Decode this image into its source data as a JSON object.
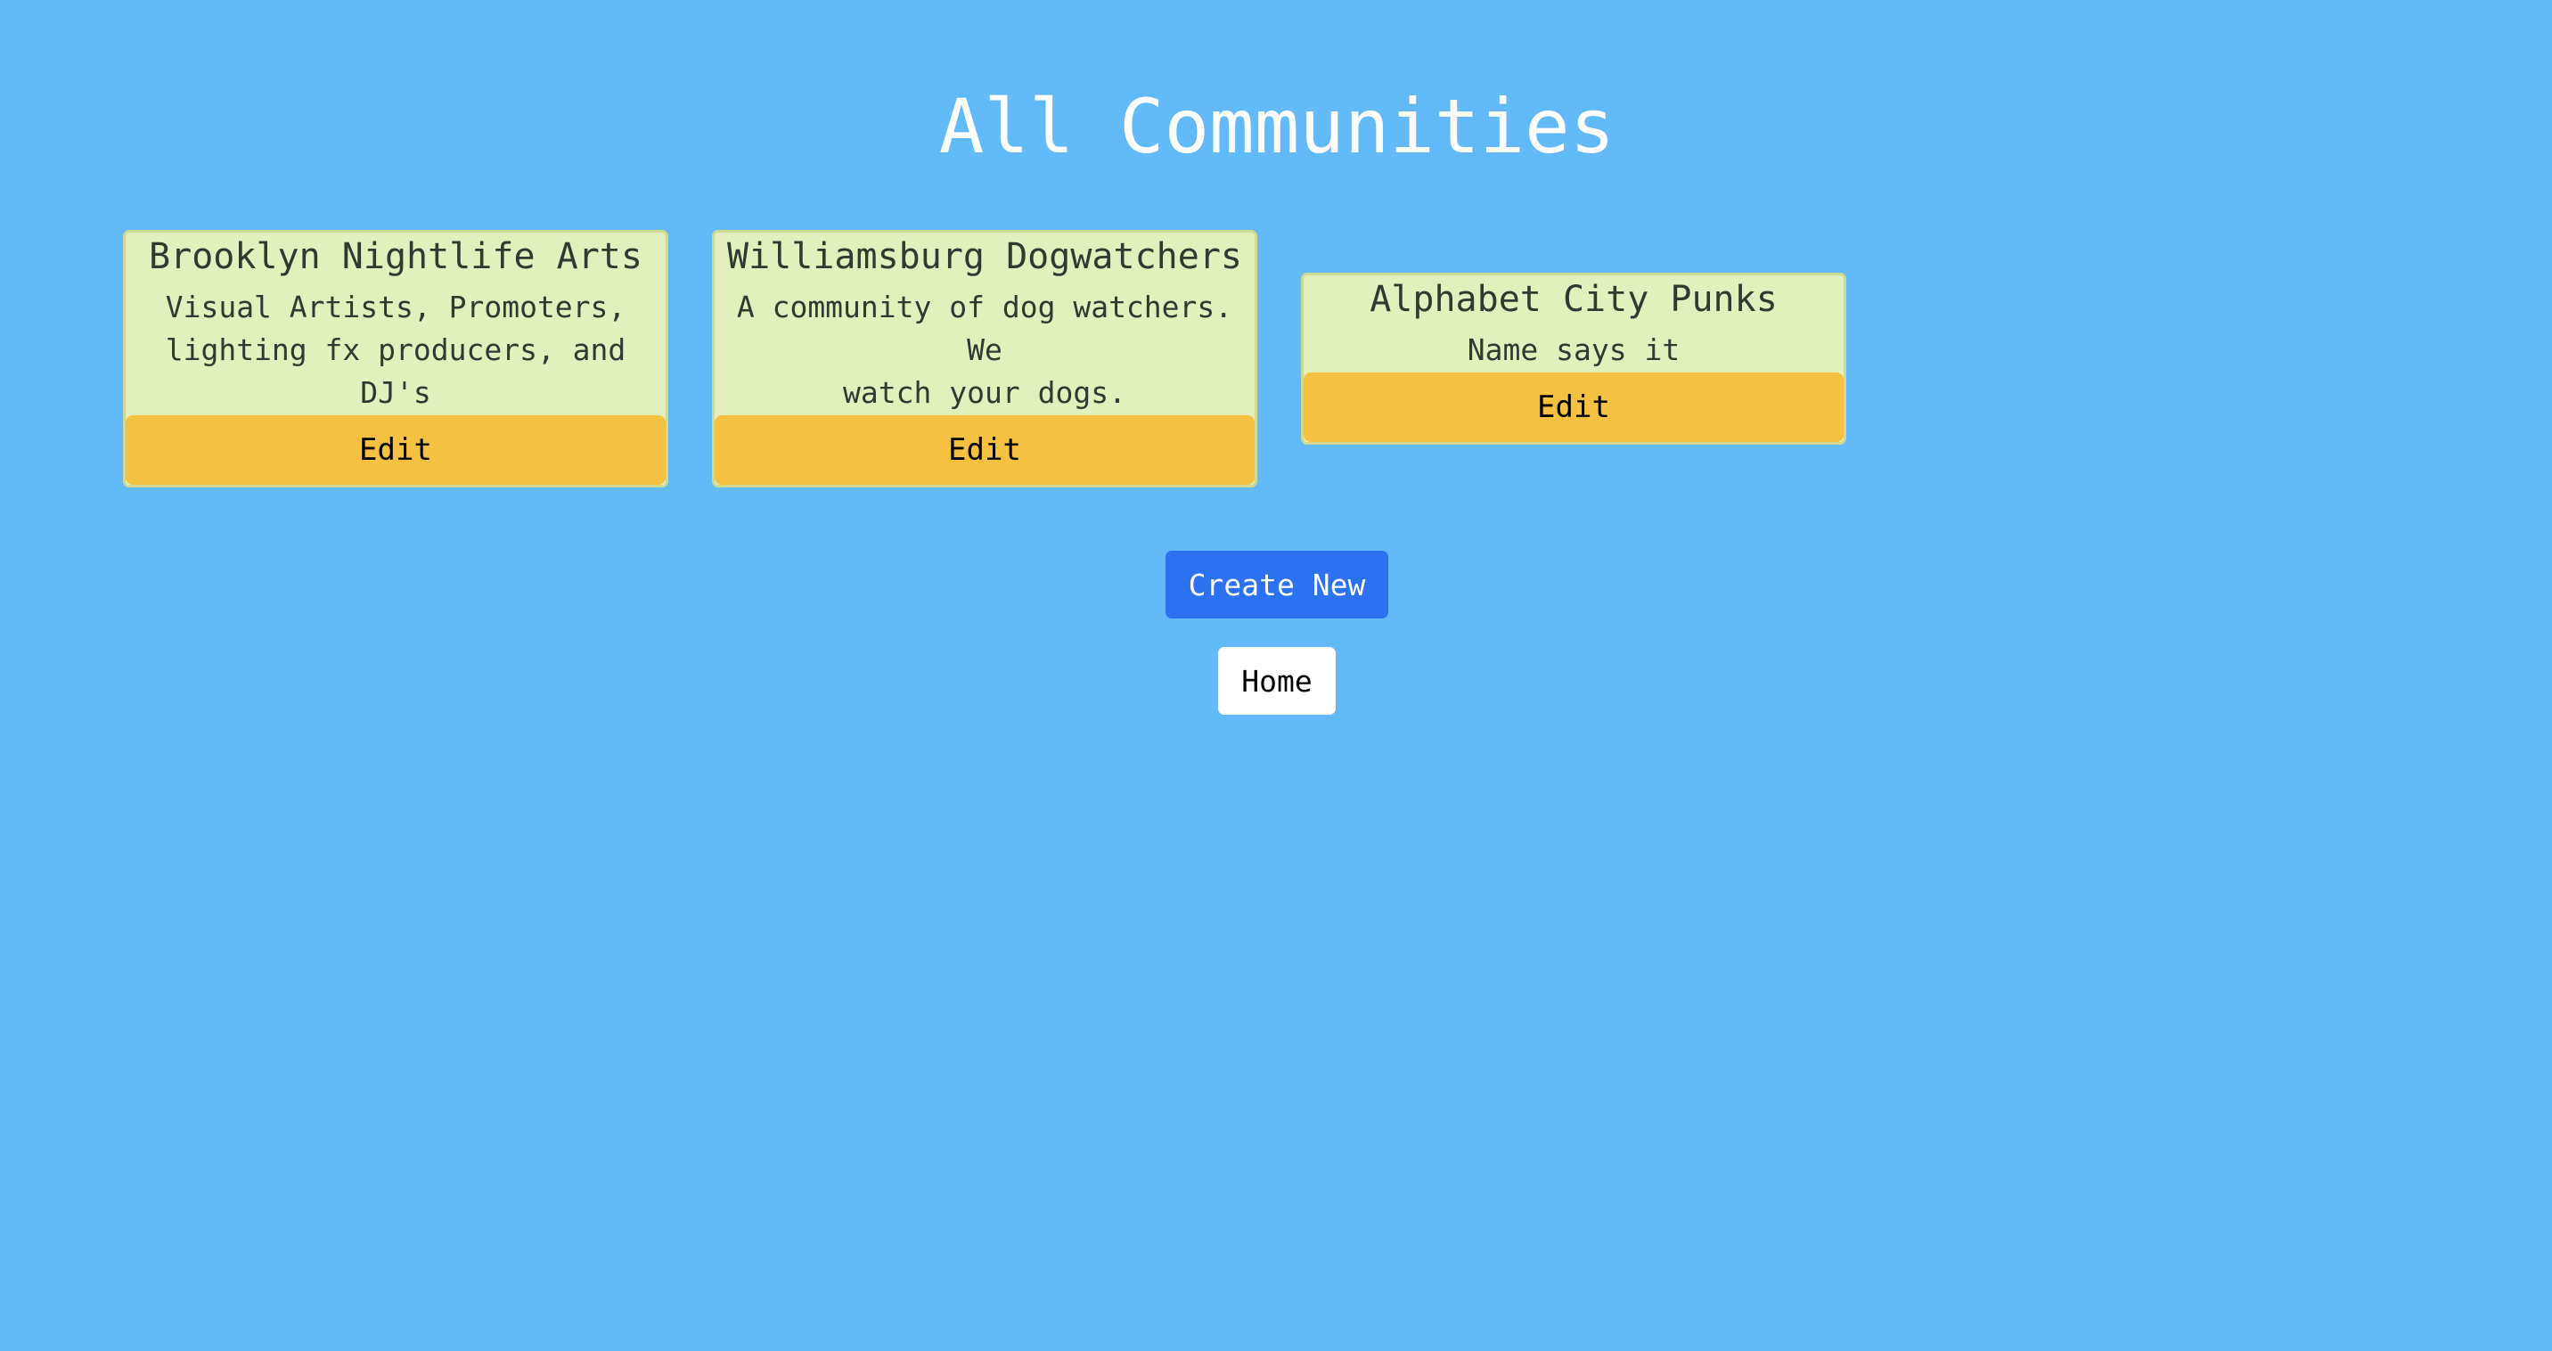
{
  "page": {
    "title": "All Communities"
  },
  "communities": [
    {
      "name": "Brooklyn Nightlife Arts",
      "description": "Visual Artists, Promoters,\nlighting fx producers, and DJ's",
      "edit_label": "Edit"
    },
    {
      "name": "Williamsburg Dogwatchers",
      "description": "A community of dog watchers. We\nwatch your dogs.",
      "edit_label": "Edit"
    },
    {
      "name": "Alphabet City Punks",
      "description": "Name says it",
      "edit_label": "Edit"
    }
  ],
  "actions": {
    "create_label": "Create New",
    "home_label": "Home"
  },
  "colors": {
    "background": "#63baf8",
    "card_background": "#e2f0bd",
    "edit_button": "#f5c143",
    "create_button": "#2b71f0",
    "home_button": "#ffffff"
  }
}
